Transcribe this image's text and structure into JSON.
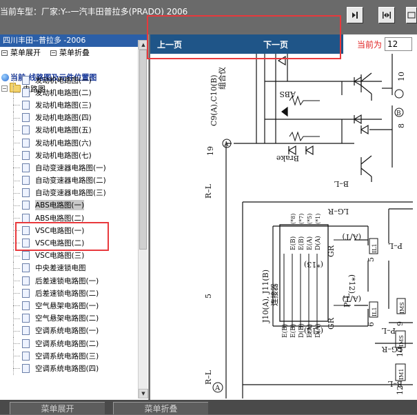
{
  "topbar": {
    "car_title": "当前车型：厂家:Y--一汽丰田普拉多(PRADO) 2006",
    "buttons": [
      "fit-page-icon",
      "fit-width-icon",
      "zoom-icon"
    ]
  },
  "left": {
    "header": "四川丰田--普拉多 -2006",
    "expand_label": "菜单展开",
    "collapse_label": "菜单折叠",
    "current": "当前:线路图及元件位置图",
    "root_label": "电路图",
    "items": [
      "发动机电路图(一)",
      "发动机电路图(二)",
      "发动机电路图(三)",
      "发动机电路图(四)",
      "发动机电路图(五)",
      "发动机电路图(六)",
      "发动机电路图(七)",
      "自动变速器电路图(一)",
      "自动变速器电路图(二)",
      "自动变速器电路图(三)",
      "ABS电路图(一)",
      "ABS电路图(二)",
      "VSC电路图(一)",
      "VSC电路图(二)",
      "VSC电路图(三)",
      "中央差速锁电图",
      "后差速锁电路图(一)",
      "后差速锁电路图(二)",
      "空气悬架电路图(一)",
      "空气悬架电路图(二)",
      "空调系统电路图(一)",
      "空调系统电路图(二)",
      "空调系统电路图(三)",
      "空调系统电路图(四)"
    ],
    "selected_index": 10
  },
  "right": {
    "prev_label": "上一页",
    "next_label": "下一页",
    "page_label": "当前为",
    "page_value": "12"
  },
  "diagram": {
    "labels": {
      "c9": "C9(A),C10(B)",
      "combo": "组合仪",
      "abs": "ABS",
      "brake": "Brake",
      "r_l": "R–L",
      "b_l": "B–L",
      "lg_r": "LG–R",
      "p_l": "P–L",
      "gr": "GR",
      "connector": "J10(A), J11(B)",
      "connector_cn": "连接器",
      "at": "(A/T)",
      "star13": "(*13)",
      "star12": "(*12)",
      "star8": "(*8)",
      "star7": "(*7)",
      "star5": "(*5)",
      "star1": "(*1)",
      "pins_left": [
        "E(B)",
        "E(B)",
        "D(B)",
        "E(A)",
        "D(A)"
      ],
      "pins_top": [
        "E(B)",
        "E(B)",
        "E(A)",
        "D(A)"
      ],
      "num_19": "19",
      "num_8": "8",
      "num_10": "10",
      "num_5": "5",
      "num_6": "6",
      "num_9": "9",
      "num_12": "12",
      "conn_il1": "IL1",
      "conn_ims": "IMS",
      "conn_im1": "IM1",
      "pin_a": "A",
      "pin_b": "B"
    }
  },
  "bottom": {
    "expand_label": "菜单展开",
    "collapse_label": "菜单折叠"
  },
  "colors": {
    "title_bg": "#6a6a6a",
    "header_blue": "#2b5fa8",
    "pager_blue": "#1f5588",
    "highlight_red": "#e8383c",
    "page_label_red": "#e02020"
  }
}
